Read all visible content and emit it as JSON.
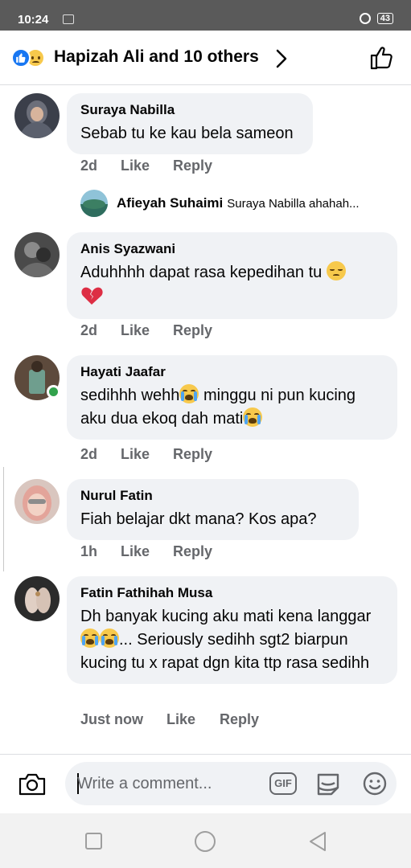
{
  "status_bar": {
    "time": "10:24",
    "battery": "43"
  },
  "header": {
    "title": "Hapizah Ali and 10 others"
  },
  "comments": [
    {
      "author": "Suraya Nabilla",
      "text": "Sebab tu ke kau bela sameon",
      "time": "2d"
    },
    {
      "author": "Anis Syazwani",
      "text": "Aduhhhh dapat rasa kepedihan tu",
      "time": "2d"
    },
    {
      "author": "Hayati Jaafar",
      "text_a": "sedihhh wehh",
      "text_b": " minggu ni pun kucing aku dua ekoq dah mati",
      "time": "2d"
    },
    {
      "author": "Nurul Fatin",
      "text": "Fiah belajar dkt mana? Kos apa?",
      "time": "1h"
    },
    {
      "author": "Fatin Fathihah Musa",
      "text_a": "Dh banyak kucing aku mati kena langgar ",
      "text_b": "... Seriously sedihh sgt2 biarpun kucing tu x rapat dgn kita ttp rasa sedihh",
      "time": "Just now"
    }
  ],
  "reply_preview": {
    "author": "Afieyah Suhaimi",
    "text": "Suraya Nabilla ahahah..."
  },
  "actions": {
    "like": "Like",
    "reply": "Reply"
  },
  "composer": {
    "placeholder": "Write a comment...",
    "gif": "GIF"
  }
}
